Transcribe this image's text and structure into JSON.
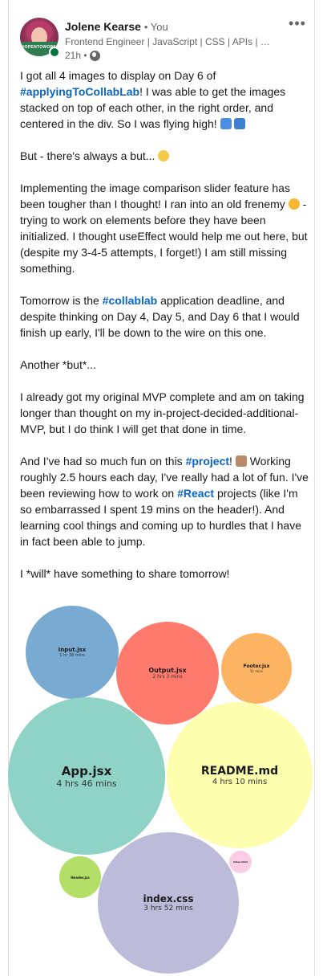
{
  "post": {
    "author": {
      "name": "Jolene Kearse",
      "relation": "• You",
      "headline": "Frontend Engineer | JavaScript | CSS | APIs | We...",
      "time": "21h •",
      "avatar_badge": "#OPENTOWORK",
      "menu_label": "•••"
    },
    "paragraphs": {
      "p1": {
        "a": "I got all 4 images to display on Day 6 of",
        "tag": "#applyingToCollabLab",
        "b": "! I was able to get the images stacked on top of each other, in the right order, and centered in the div. So I was flying high!"
      },
      "p2": "But - there's always a but...",
      "p3a": "Implementing the image comparison slider feature has been tougher than I thought! I ran into an old frenemy",
      "p3b": "- trying to work on elements before they have been initialized. I thought useEffect would help me out here, but (despite my 3-4-5 attempts, I forget!) I am still missing something.",
      "p4": {
        "a": "Tomorrow is the",
        "tag": "#collablab",
        "b": "application deadline, and despite thinking on Day 4, Day 5, and Day 6 that I would finish up early, I'll be down to the wire on this one."
      },
      "p5": "Another *but*...",
      "p6": "I already got my original MVP complete and am on taking longer than thought on my in-project-decided-additional-MVP, but I do think I will get that done in time.",
      "p7": {
        "a": "And I've had so much fun on this",
        "tag1": "#project",
        "b": "! ",
        "c": "Working roughly 2.5 hours each day, I've really had a lot of fun. I've been reviewing how to work on",
        "tag2": "#React",
        "d": "projects (like I'm so embarrassed I spent 19 mins on the header!). And learning cool things and coming up to hurdles that I have in fact been able to jump."
      },
      "p8": "I *will* have something to share tomorrow!"
    },
    "emojis": [
      "airplane-emoji",
      "person-emoji",
      "grinning-sweat-emoji",
      "flushed-face-emoji",
      "clapping-hands-emoji"
    ]
  },
  "chart_data": {
    "type": "bubble",
    "title": "",
    "series": [
      {
        "label": "Input.jsx",
        "value": "1 hr 38 mins",
        "color": "#78aad2"
      },
      {
        "label": "Output.jsx",
        "value": "2 hrs 3 mins",
        "color": "#fe7a6c"
      },
      {
        "label": "Footer.jsx",
        "value": "51 mins",
        "color": "#fdb462"
      },
      {
        "label": "App.jsx",
        "value": "4 hrs 46 mins",
        "color": "#8fd3c6"
      },
      {
        "label": "README.md",
        "value": "4 hrs 10 mins",
        "color": "#fefeaf"
      },
      {
        "label": "Header.jsx",
        "value": "",
        "color": "#b3de68"
      },
      {
        "label": "index.css",
        "value": "3 hrs 52 mins",
        "color": "#bcbbda"
      },
      {
        "label": "index.html",
        "value": "",
        "color": "#fbcde4"
      }
    ]
  },
  "colors": {
    "hashtag": "#0a66c2",
    "muted": "#666666",
    "online": "#057642"
  }
}
